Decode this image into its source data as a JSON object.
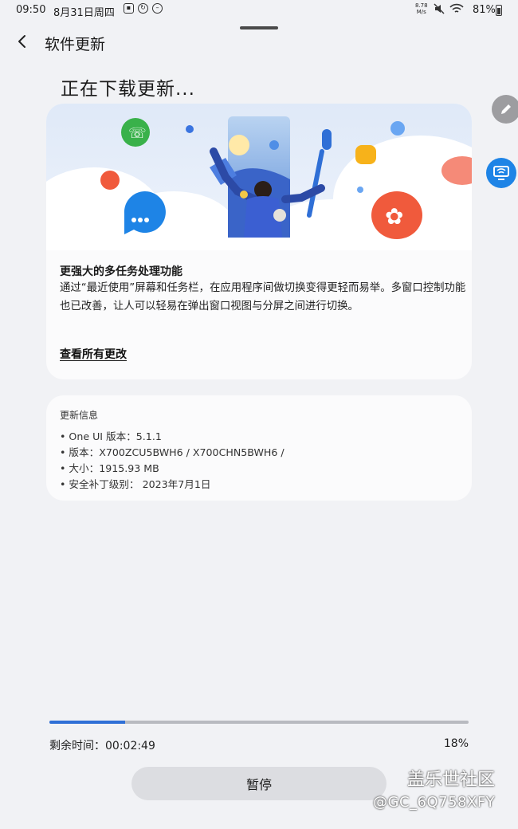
{
  "status_bar": {
    "time": "09:50",
    "date": "8月31日周四",
    "net_speed_value": "8.78",
    "net_speed_unit": "M/s",
    "battery": "81%"
  },
  "header": {
    "back_icon": "chevron-left-icon",
    "title": "软件更新"
  },
  "page": {
    "heading": "正在下载更新..."
  },
  "feature": {
    "title": "更强大的多任务处理功能",
    "description": "通过“最近使用”屏幕和任务栏，在应用程序间做切换变得更轻而易举。多窗口控制功能也已改善，让人可以轻易在弹出窗口视图与分屏之间进行切换。",
    "see_all": "查看所有更改"
  },
  "update_info": {
    "title": "更新信息",
    "items": [
      "• One UI 版本：5.1.1",
      "• 版本：X700ZCU5BWH6 / X700CHN5BWH6 /",
      "• 大小：1915.93 MB",
      "• 安全补丁级别： 2023年7月1日"
    ]
  },
  "download": {
    "remaining_label": "剩余时间：00:02:49",
    "percent_label": "18%",
    "progress_fraction": 0.18
  },
  "actions": {
    "pause": "暂停"
  },
  "floating": {
    "edit_icon": "pencil-icon",
    "cast_icon": "screen-share-icon"
  },
  "watermark": {
    "line1": "盖乐世社区",
    "line2": "@GC_6Q758XFY"
  },
  "colors": {
    "accent": "#2f6fd6",
    "background": "#f1f2f5",
    "card": "#fbfbfc"
  }
}
